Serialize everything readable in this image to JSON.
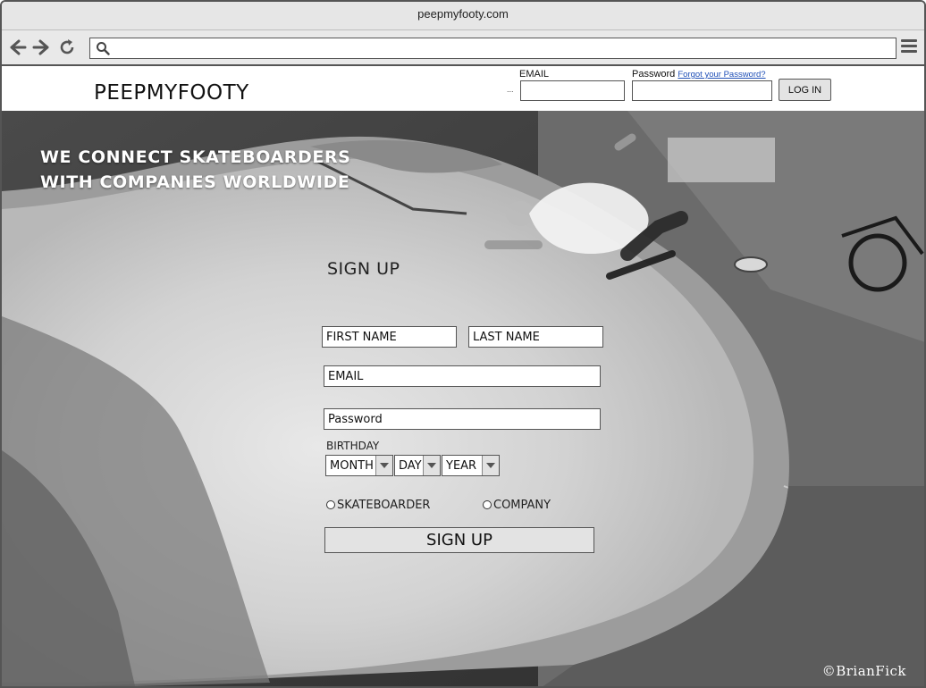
{
  "browser": {
    "title": "peepmyfooty.com",
    "url": ""
  },
  "header": {
    "logo": "PEEPMYFOOTY",
    "email_label": "EMAIL",
    "password_label": "Password",
    "forgot_link": "Forgot your Password?",
    "ellipsis": "...",
    "login_button": "LOG IN"
  },
  "hero": {
    "tagline_line1": "WE CONNECT SKATEBOARDERS",
    "tagline_line2": "WITH COMPANIES WORLDWIDE",
    "credit": "©BrianFick"
  },
  "signup": {
    "title": "SIGN UP",
    "first_name_placeholder": "FIRST NAME",
    "last_name_placeholder": "LAST NAME",
    "email_placeholder": "EMAIL",
    "password_placeholder": "Password",
    "birthday_label": "BIRTHDAY",
    "month": "MONTH",
    "day": "DAY",
    "year": "YEAR",
    "radio_skateboarder": "SKATEBOARDER",
    "radio_company": "COMPANY",
    "submit_label": "SIGN UP"
  },
  "colors": {
    "link": "#1f4fb7",
    "button_bg": "#e3e3e3",
    "chrome_bg": "#e6e6e6"
  }
}
